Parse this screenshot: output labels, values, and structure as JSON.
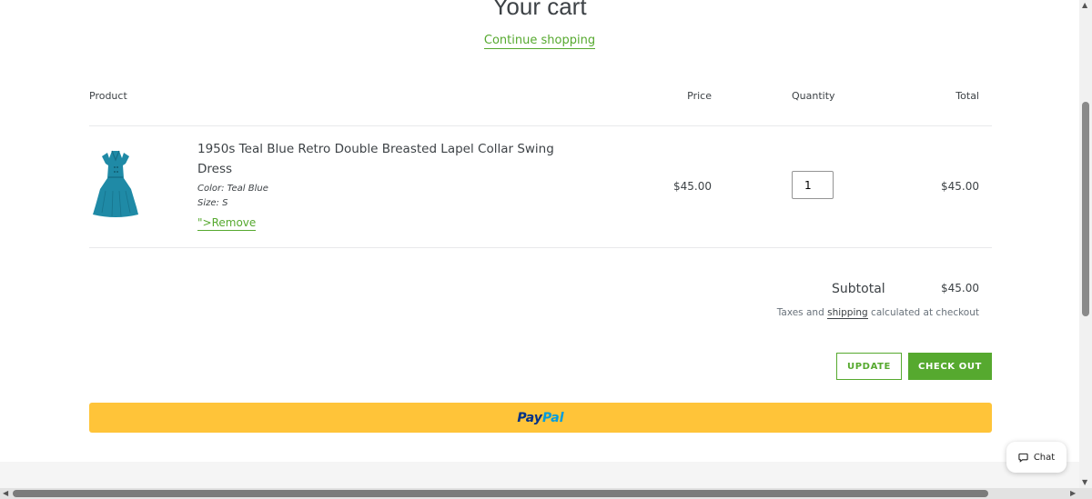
{
  "page": {
    "title": "Your cart",
    "continue_link": "Continue shopping"
  },
  "table": {
    "headers": {
      "product": "Product",
      "price": "Price",
      "quantity": "Quantity",
      "total": "Total"
    },
    "items": [
      {
        "name": "1950s Teal Blue Retro Double Breasted Lapel Collar Swing Dress",
        "color": "Color: Teal Blue",
        "size": "Size: S",
        "remove": "\">Remove",
        "price": "$45.00",
        "quantity": "1",
        "total": "$45.00",
        "image_icon": "teal-dress-icon"
      }
    ]
  },
  "summary": {
    "subtotal_label": "Subtotal",
    "subtotal_value": "$45.00",
    "tax_before": "Taxes and ",
    "tax_link": "shipping",
    "tax_after": " calculated at checkout"
  },
  "buttons": {
    "update": "UPDATE",
    "checkout": "CHECK OUT",
    "paypal_part1": "Pay",
    "paypal_part2": "Pal"
  },
  "chat": {
    "label": "Chat",
    "icon": "chat-bubble-icon"
  },
  "colors": {
    "accent": "#56a92f",
    "paypal_yellow": "#ffc439",
    "paypal_dark_blue": "#003087",
    "paypal_light_blue": "#009cde",
    "text": "#3d4246",
    "dress": "#1f8aa6"
  }
}
